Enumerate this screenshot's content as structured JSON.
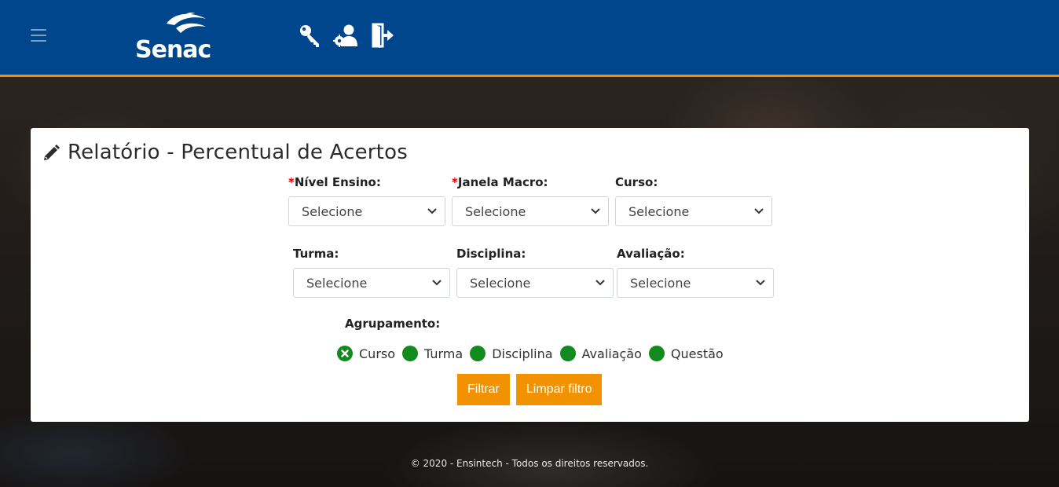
{
  "header": {
    "logo_text": "Senac",
    "icons": [
      "key-icon",
      "user-settings-icon",
      "logout-icon"
    ]
  },
  "page": {
    "title": "Relatório - Percentual de Acertos"
  },
  "filters": {
    "nivel_ensino": {
      "required_mark": "*",
      "label": "Nível Ensino:",
      "value": "Selecione"
    },
    "janela_macro": {
      "required_mark": "*",
      "label": "Janela Macro:",
      "value": "Selecione"
    },
    "curso": {
      "label": "Curso:",
      "value": "Selecione"
    },
    "turma": {
      "label": "Turma:",
      "value": "Selecione"
    },
    "disciplina": {
      "label": "Disciplina:",
      "value": "Selecione"
    },
    "avaliacao": {
      "label": "Avaliação:",
      "value": "Selecione"
    }
  },
  "agrupamento": {
    "label": "Agrupamento:",
    "options": [
      {
        "label": "Curso",
        "selected": true
      },
      {
        "label": "Turma",
        "selected": false
      },
      {
        "label": "Disciplina",
        "selected": false
      },
      {
        "label": "Avaliação",
        "selected": false
      },
      {
        "label": "Questão",
        "selected": false
      }
    ]
  },
  "buttons": {
    "filter": "Filtrar",
    "clear": "Limpar filtro"
  },
  "footer": {
    "text": "© 2020 - Ensintech - Todos os direitos reservados."
  },
  "colors": {
    "header_bg": "#00468c",
    "accent": "#f39200",
    "radio_green": "#138a1e",
    "required": "#e00000"
  }
}
